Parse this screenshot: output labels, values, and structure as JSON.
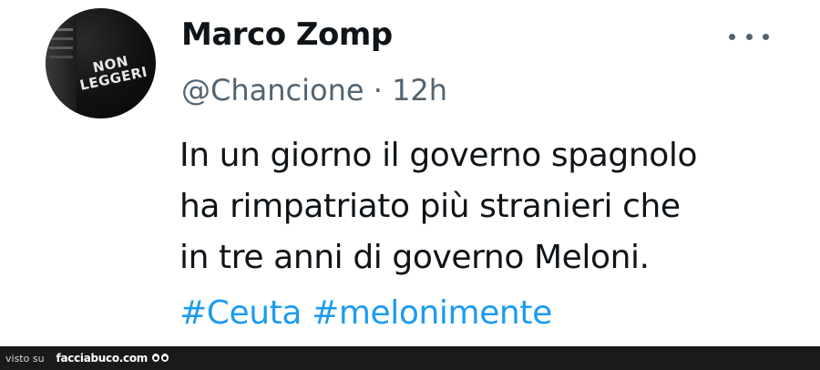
{
  "tweet": {
    "avatar": {
      "shirt_line1": "NON",
      "shirt_line2": "LEGGERI"
    },
    "display_name": "Marco Zomp",
    "handle": "@Chancione",
    "separator": "·",
    "time": "12h",
    "more_icon": "more-horizontal-icon",
    "text_lines": [
      "In un giorno il governo spagnolo",
      "ha rimpatriato più stranieri che",
      "in tre anni di governo Meloni."
    ],
    "hashtags": [
      "#Ceuta",
      "#melonimente"
    ]
  },
  "footer": {
    "visto_label": "visto su",
    "site_label": "facciabuco.com",
    "logo_icon": "eyes-icon"
  },
  "colors": {
    "text": "#0f1419",
    "secondary": "#536471",
    "link": "#1d9bf0",
    "footer_bg": "#1a1a1a"
  }
}
